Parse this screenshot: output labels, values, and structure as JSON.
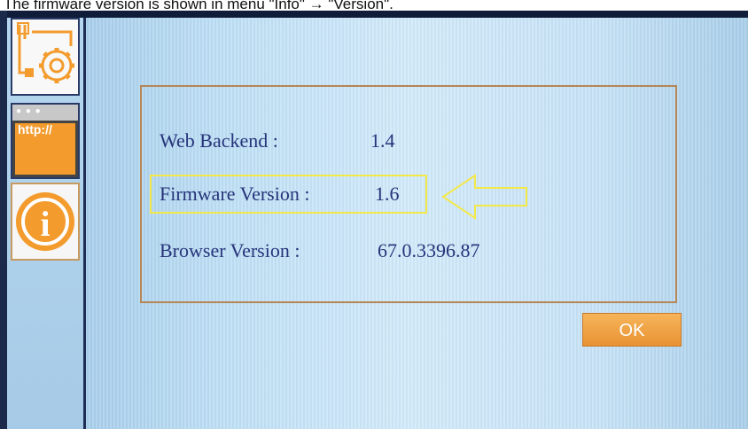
{
  "caption": "The firmware version is shown in menu \"Info\" → \"Version\".",
  "sidebar": {
    "items": [
      {
        "name": "settings",
        "icon": "settings-gear-icon"
      },
      {
        "name": "web",
        "icon": "browser-window-icon",
        "label": "http://"
      },
      {
        "name": "info",
        "icon": "info-icon",
        "label": "i"
      }
    ]
  },
  "version_dialog": {
    "web_backend_label": "Web Backend :",
    "web_backend_value": "1.4",
    "firmware_label": "Firmware Version :",
    "firmware_value": "1.6",
    "browser_label": "Browser Version :",
    "browser_value": "67.0.3396.87"
  },
  "ok_button": {
    "label": "OK"
  },
  "colors": {
    "accent_orange": "#f39b2d",
    "highlight_yellow": "#f3e84a",
    "text_blue": "#26347a",
    "dialog_border": "#b58656"
  }
}
